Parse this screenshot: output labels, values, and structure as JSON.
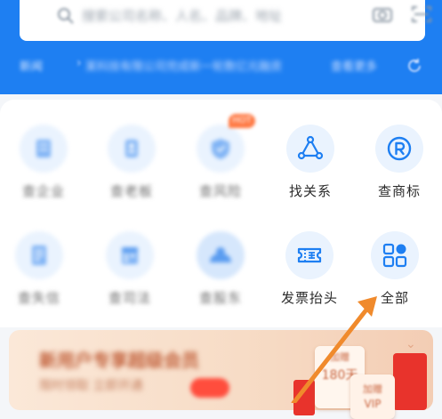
{
  "header": {
    "search": {
      "placeholder": "搜索公司名称、人名、品牌、地址",
      "icon": "search-icon",
      "camera_icon": "camera-icon",
      "scan_icon": "scan-icon"
    },
    "news": {
      "tag": "新闻",
      "text": "某科技有限公司完成新一轮数亿元融资",
      "more": "查看更多",
      "refresh_icon": "refresh-icon"
    },
    "brand_color": "#1e7ff2"
  },
  "grid": {
    "row1": [
      {
        "label": "查企业",
        "icon": "building-icon",
        "blurred": true
      },
      {
        "label": "查老板",
        "icon": "person-icon",
        "blurred": true
      },
      {
        "label": "查风险",
        "icon": "shield-icon",
        "blurred": true,
        "badge": "HOT"
      },
      {
        "label": "找关系",
        "icon": "relation-icon",
        "blurred": false
      },
      {
        "label": "查商标",
        "icon": "trademark-icon",
        "blurred": false
      }
    ],
    "row2": [
      {
        "label": "查失信",
        "icon": "document-icon",
        "blurred": true
      },
      {
        "label": "查司法",
        "icon": "calendar-icon",
        "blurred": true
      },
      {
        "label": "查股东",
        "icon": "cloud-icon",
        "blurred": true
      },
      {
        "label": "发票抬头",
        "icon": "invoice-icon",
        "blurred": false
      },
      {
        "label": "全部",
        "icon": "all-apps-icon",
        "blurred": false
      }
    ],
    "icon_color": "#1e7ff2",
    "icon_bg": "#eaf3fe"
  },
  "banner": {
    "title": "新用户专享超级会员",
    "subtitle": "限时领取 立即开通",
    "coupon1": {
      "top": "加赠",
      "value": "180天"
    },
    "coupon2": {
      "top": "加赠",
      "value": "VIP"
    },
    "close_icon": "chevron-down-icon"
  },
  "annotation": {
    "arrow_color": "#f08a2c"
  }
}
